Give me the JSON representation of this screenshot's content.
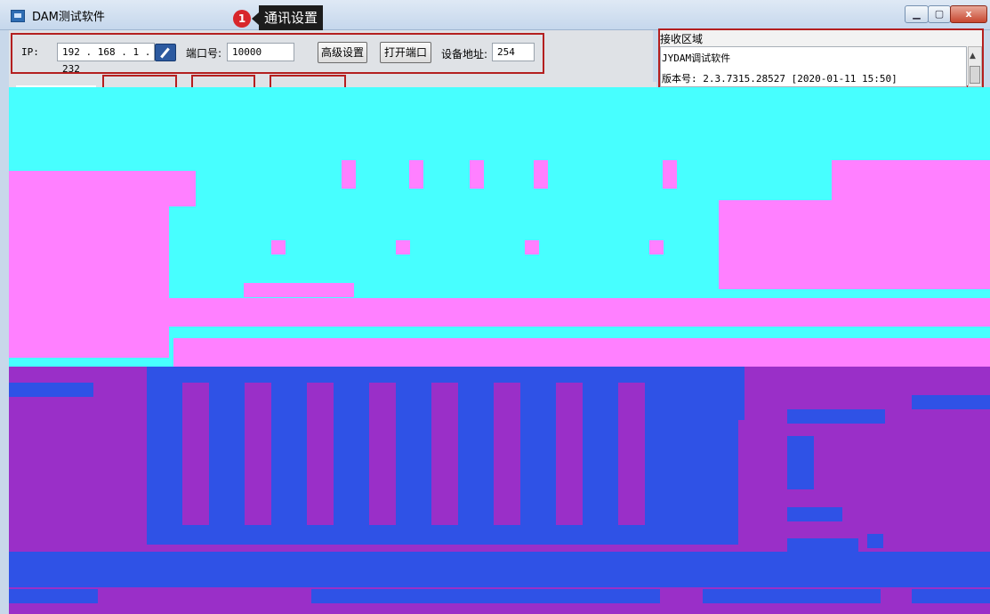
{
  "window": {
    "title": "DAM测试软件",
    "minimize_glyph": "▁",
    "maximize_glyph": "▢",
    "close_glyph": "x"
  },
  "tooltip": {
    "badge": "1",
    "text": "通讯设置"
  },
  "settings": {
    "ip_label": "IP:",
    "ip_value": "192 . 168 . 1 . 232",
    "port_label": "端口号:",
    "port_value": "10000",
    "advanced_button": "高级设置",
    "open_port_button": "打开端口",
    "device_address_label": "设备地址:",
    "device_address_value": "254"
  },
  "receive": {
    "title": "接收区域",
    "lines": [
      "JYDAM调试软件",
      "版本号: 2.3.7315.28527 [2020-01-11 15:50]"
    ]
  },
  "colors": {
    "highlight_red": "#b41f1f",
    "glitch_cyan": "#47ffff",
    "glitch_pink": "#ff80ff",
    "glitch_purple": "#9a2fc8",
    "glitch_blue": "#2f52e6"
  },
  "icons": {
    "app": "app-window-icon",
    "edit_ip": "pencil-icon"
  }
}
